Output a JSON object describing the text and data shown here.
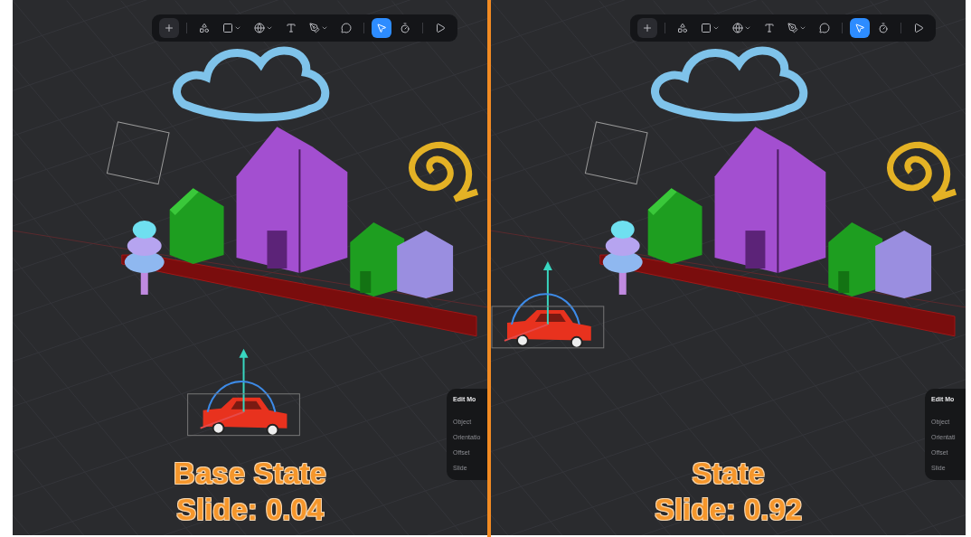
{
  "panels": [
    {
      "toolbar": {
        "groups": [
          [
            {
              "kind": "add",
              "selected": false,
              "has_menu": false
            }
          ],
          [
            {
              "kind": "shapes",
              "selected": false,
              "has_menu": false
            },
            {
              "kind": "square",
              "selected": false,
              "has_menu": true
            },
            {
              "kind": "sphere",
              "selected": false,
              "has_menu": true
            },
            {
              "kind": "text",
              "selected": false,
              "has_menu": false
            },
            {
              "kind": "pen",
              "selected": false,
              "has_menu": true
            },
            {
              "kind": "comment",
              "selected": false,
              "has_menu": false
            }
          ],
          [
            {
              "kind": "pointer",
              "selected": true,
              "has_menu": false
            },
            {
              "kind": "timer",
              "selected": false,
              "has_menu": false
            }
          ],
          [
            {
              "kind": "play",
              "selected": false,
              "has_menu": false
            }
          ]
        ]
      },
      "edit_panel": {
        "title": "Edit Mo",
        "rows": [
          "Object",
          "Orientatio",
          "Offset",
          "Slide"
        ]
      },
      "car": {
        "moved": false
      },
      "caption": [
        "Base State",
        "Slide: 0.04"
      ]
    },
    {
      "toolbar": {
        "groups": [
          [
            {
              "kind": "add",
              "selected": false,
              "has_menu": false
            }
          ],
          [
            {
              "kind": "shapes",
              "selected": false,
              "has_menu": false
            },
            {
              "kind": "square",
              "selected": false,
              "has_menu": true
            },
            {
              "kind": "sphere",
              "selected": false,
              "has_menu": true
            },
            {
              "kind": "text",
              "selected": false,
              "has_menu": false
            },
            {
              "kind": "pen",
              "selected": false,
              "has_menu": true
            },
            {
              "kind": "comment",
              "selected": false,
              "has_menu": false
            }
          ],
          [
            {
              "kind": "pointer",
              "selected": true,
              "has_menu": false
            },
            {
              "kind": "timer",
              "selected": false,
              "has_menu": false
            }
          ],
          [
            {
              "kind": "play",
              "selected": false,
              "has_menu": false
            }
          ]
        ]
      },
      "edit_panel": {
        "title": "Edit Mo",
        "rows": [
          "Object",
          "Orientati",
          "Offset",
          "Slide"
        ]
      },
      "car": {
        "moved": true
      },
      "caption": [
        "State",
        "Slide: 0.92"
      ]
    }
  ]
}
